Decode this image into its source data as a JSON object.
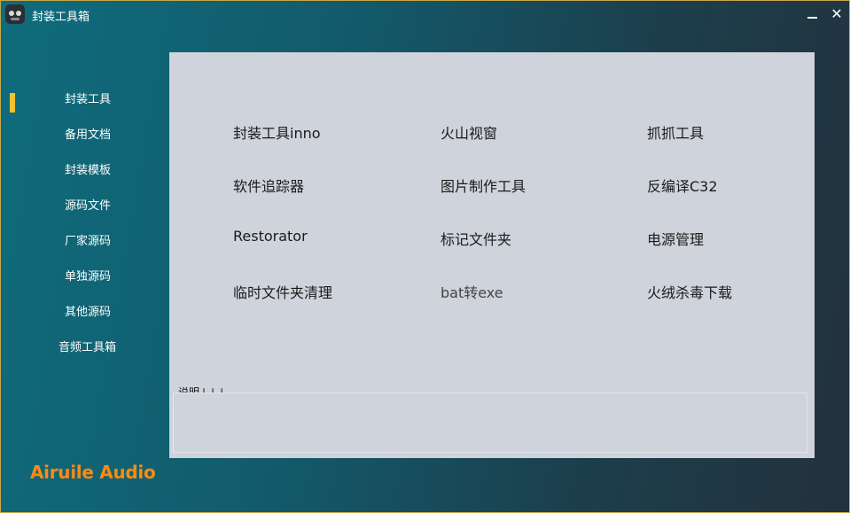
{
  "window": {
    "title": "封装工具箱",
    "minimize_symbol": "",
    "close_symbol": "✕"
  },
  "sidebar": {
    "items": [
      {
        "label": "封装工具",
        "active": true
      },
      {
        "label": "备用文档"
      },
      {
        "label": "封装模板"
      },
      {
        "label": "源码文件"
      },
      {
        "label": "厂家源码"
      },
      {
        "label": "单独源码"
      },
      {
        "label": "其他源码"
      },
      {
        "label": "音频工具箱"
      }
    ],
    "active_color": "#f2c230"
  },
  "brand": {
    "label": "Airuile Audio",
    "color": "#ff8a12"
  },
  "tools": [
    [
      "封装工具inno",
      "火山视窗",
      "抓抓工具"
    ],
    [
      "软件追踪器",
      "图片制作工具",
      "反编译C32"
    ],
    [
      "Restorator",
      "标记文件夹",
      "电源管理"
    ],
    [
      "临时文件夹清理",
      "bat转exe",
      "火绒杀毒下载"
    ]
  ],
  "description": {
    "label": "说明↓↓↓",
    "text": ""
  }
}
